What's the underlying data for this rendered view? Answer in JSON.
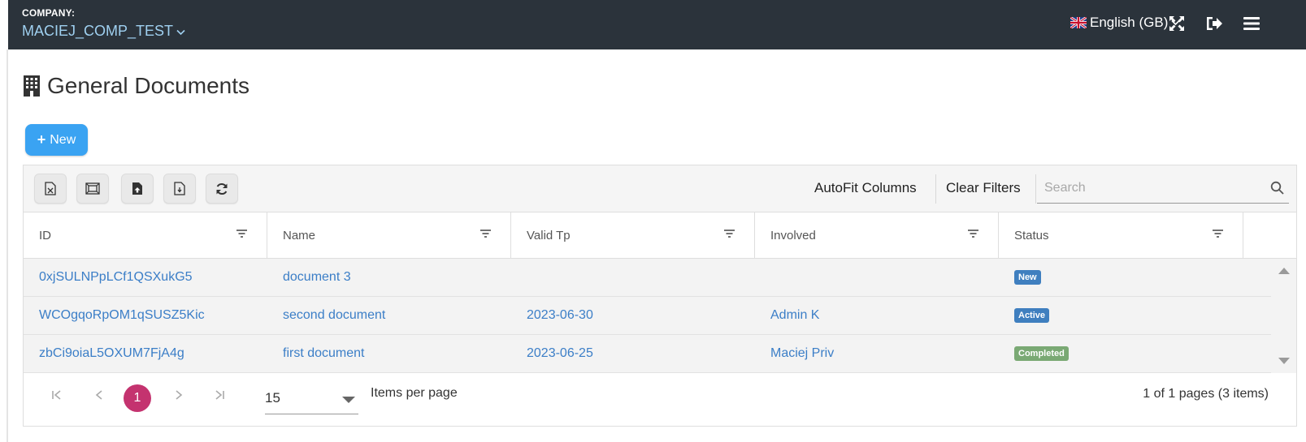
{
  "topbar": {
    "company_label": "COMPANY:",
    "company_name": "MACIEJ_COMP_TEST",
    "language": "English (GB)",
    "icons": [
      "expand-icon",
      "logout-icon",
      "hamburger-menu-icon"
    ]
  },
  "page": {
    "title": "General Documents",
    "new_button": "New"
  },
  "toolbar": {
    "buttons": [
      "excel-export-icon",
      "image-export-icon",
      "upload-file-icon",
      "download-file-icon",
      "refresh-icon"
    ],
    "autofit": "AutoFit Columns",
    "clear_filters": "Clear Filters",
    "search_placeholder": "Search"
  },
  "table": {
    "columns": [
      "ID",
      "Name",
      "Valid Tp",
      "Involved",
      "Status"
    ],
    "rows": [
      {
        "id": "0xjSULNPpLCf1QSXukG5",
        "name": "document 3",
        "valid": "",
        "involved": "",
        "status": "New"
      },
      {
        "id": "WCOgqoRpOM1qSUSZ5Kic",
        "name": "second document",
        "valid": "2023-06-30",
        "involved": "Admin K",
        "status": "Active"
      },
      {
        "id": "zbCi9oiaL5OXUM7FjA4g",
        "name": "first document",
        "valid": "2023-06-25",
        "involved": "Maciej Priv",
        "status": "Completed"
      }
    ]
  },
  "status_colors": {
    "New": "#3f7fbf",
    "Active": "#3f7fbf",
    "Completed": "#7aa974"
  },
  "pager": {
    "current_page": "1",
    "per_page": "15",
    "items_per_page_label": "Items per page",
    "info": "1 of 1 pages (3 items)"
  }
}
